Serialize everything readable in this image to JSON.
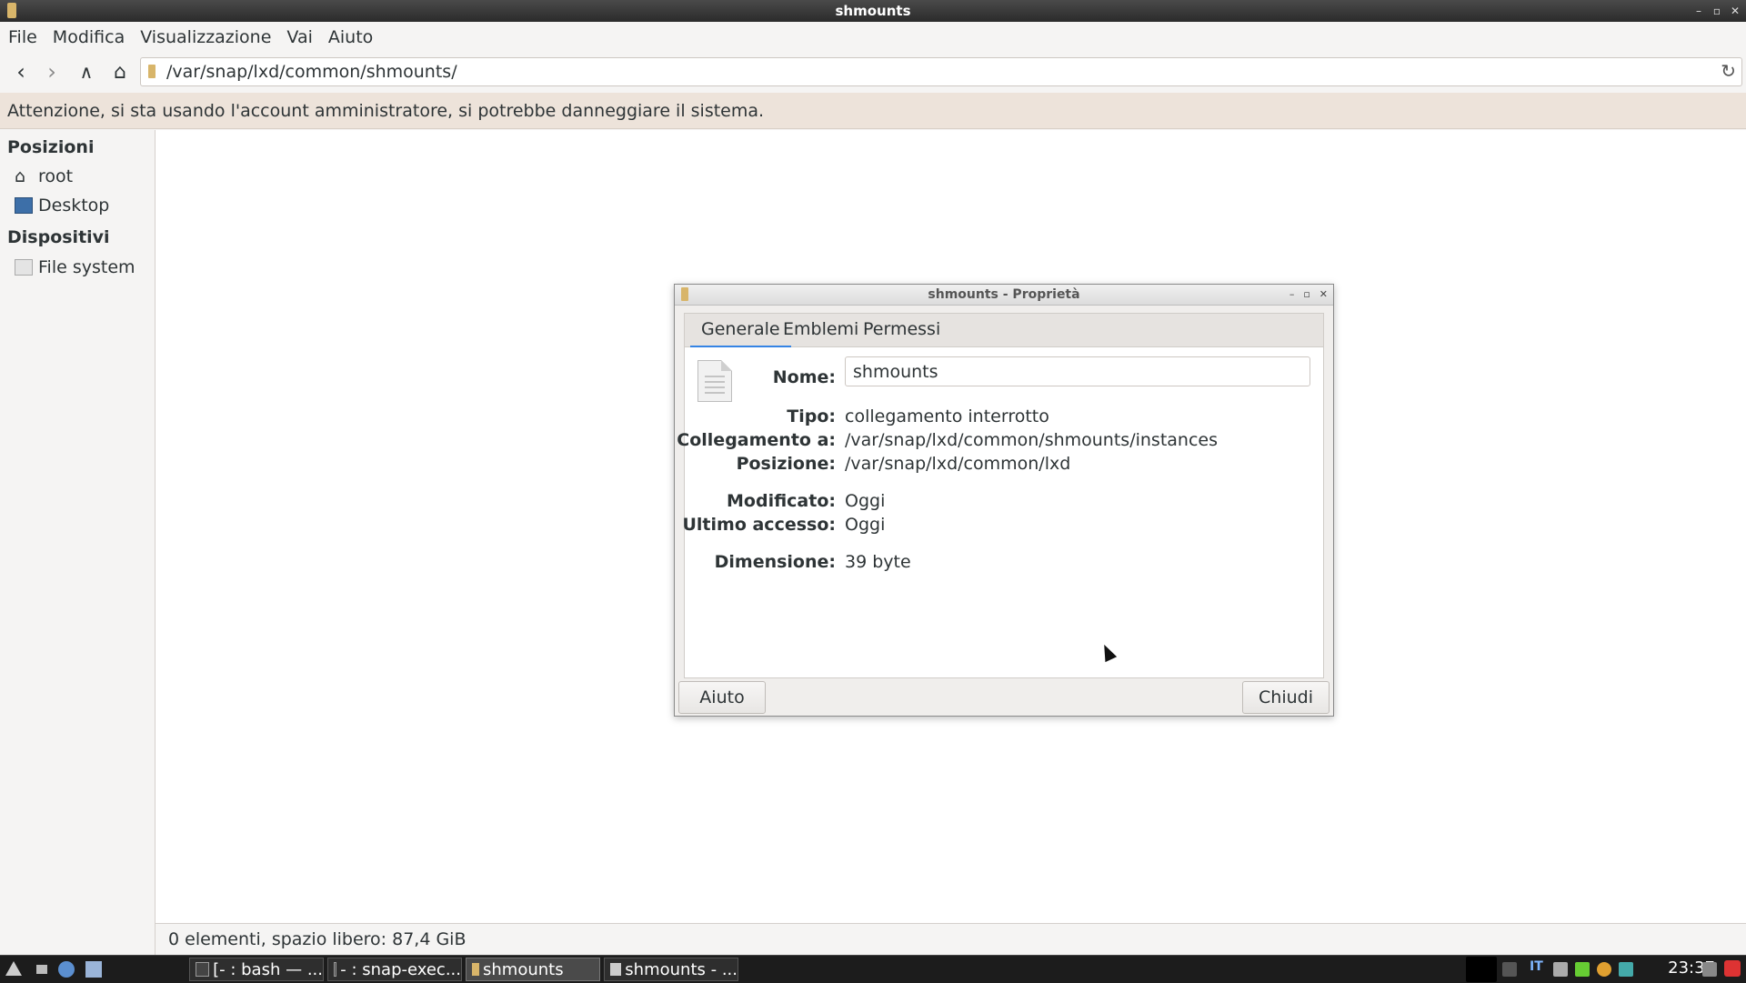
{
  "window": {
    "title": "shmounts"
  },
  "menu": [
    "File",
    "Modifica",
    "Visualizzazione",
    "Vai",
    "Aiuto"
  ],
  "toolbar": {
    "path": "/var/snap/lxd/common/shmounts/"
  },
  "warning": "Attenzione, si sta usando l'account amministratore, si potrebbe danneggiare il sistema.",
  "sidebar": {
    "places_header": "Posizioni",
    "places": [
      "root",
      "Desktop"
    ],
    "devices_header": "Dispositivi",
    "devices": [
      "File system"
    ]
  },
  "status": "0 elementi, spazio libero: 87,4 GiB",
  "dialog": {
    "title": "shmounts - Proprietà",
    "tabs": [
      "Generale",
      "Emblemi",
      "Permessi"
    ],
    "active_tab": "Generale",
    "name_label": "Nome:",
    "name_value": "shmounts",
    "type_label": "Tipo:",
    "type_value": "collegamento interrotto",
    "link_label": "Collegamento a:",
    "link_value": "/var/snap/lxd/common/shmounts/instances",
    "location_label": "Posizione:",
    "location_value": "/var/snap/lxd/common/lxd",
    "modified_label": "Modificato:",
    "modified_value": "Oggi",
    "accessed_label": "Ultimo accesso:",
    "accessed_value": "Oggi",
    "size_label": "Dimensione:",
    "size_value": "39 byte",
    "help_button": "Aiuto",
    "close_button": "Chiudi"
  },
  "taskbar": {
    "tasks": [
      "[- : bash — ...",
      "- : snap-exec...",
      "shmounts",
      "shmounts - ..."
    ],
    "active_task": "shmounts",
    "keyboard": "IT",
    "clock": "23:37"
  }
}
